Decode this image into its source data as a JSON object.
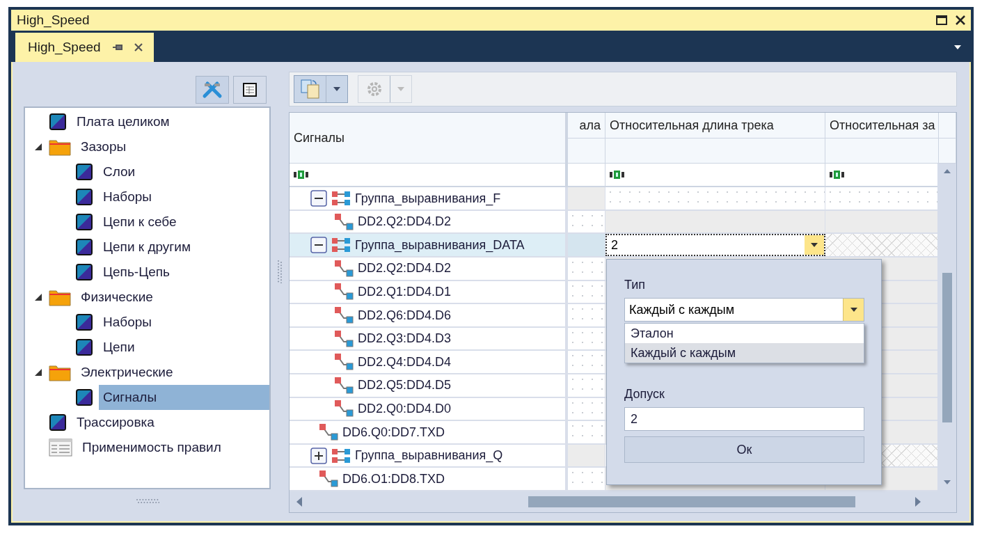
{
  "window": {
    "title": "High_Speed"
  },
  "tabs": [
    {
      "label": "High_Speed",
      "selected": true
    }
  ],
  "rule_tree": [
    {
      "label": "Плата целиком",
      "kind": "rule",
      "selected": false
    },
    {
      "label": "Зазоры",
      "kind": "folder",
      "expanded": true,
      "selected": false,
      "children": [
        {
          "label": "Слои",
          "kind": "rule",
          "selected": false
        },
        {
          "label": "Наборы",
          "kind": "rule",
          "selected": false
        },
        {
          "label": "Цепи к себе",
          "kind": "rule",
          "selected": false
        },
        {
          "label": "Цепи к другим",
          "kind": "rule",
          "selected": false
        },
        {
          "label": "Цепь-Цепь",
          "kind": "rule",
          "selected": false
        }
      ]
    },
    {
      "label": "Физические",
      "kind": "folder",
      "expanded": true,
      "selected": false,
      "children": [
        {
          "label": "Наборы",
          "kind": "rule",
          "selected": false
        },
        {
          "label": "Цепи",
          "kind": "rule",
          "selected": false
        }
      ]
    },
    {
      "label": "Электрические",
      "kind": "folder",
      "expanded": true,
      "selected": false,
      "children": [
        {
          "label": "Сигналы",
          "kind": "rule",
          "selected": true
        }
      ]
    },
    {
      "label": "Трассировка",
      "kind": "rule",
      "selected": false
    },
    {
      "label": "Применимость правил",
      "kind": "table",
      "selected": false
    }
  ],
  "grid": {
    "columns": [
      {
        "label": "Сигналы"
      },
      {
        "label": "ала"
      },
      {
        "label": "Относительная длина трека"
      },
      {
        "label": "Относительная за"
      }
    ],
    "rows": [
      {
        "label": "Группа_выравнивания_F",
        "kind": "group",
        "expanded": true,
        "selected": false,
        "children": [
          {
            "label": "DD2.Q2:DD4.D2",
            "kind": "net",
            "selected": false
          }
        ]
      },
      {
        "label": "Группа_выравнивания_DATA",
        "kind": "group",
        "expanded": true,
        "selected": true,
        "length": "2",
        "children": [
          {
            "label": "DD2.Q2:DD4.D2",
            "kind": "net",
            "selected": false
          },
          {
            "label": "DD2.Q1:DD4.D1",
            "kind": "net",
            "selected": false
          },
          {
            "label": "DD2.Q6:DD4.D6",
            "kind": "net",
            "selected": false
          },
          {
            "label": "DD2.Q3:DD4.D3",
            "kind": "net",
            "selected": false
          },
          {
            "label": "DD2.Q4:DD4.D4",
            "kind": "net",
            "selected": false
          },
          {
            "label": "DD2.Q5:DD4.D5",
            "kind": "net",
            "selected": false
          },
          {
            "label": "DD2.Q0:DD4.D0",
            "kind": "net",
            "selected": false
          }
        ]
      },
      {
        "label": "DD6.Q0:DD7.TXD",
        "kind": "net",
        "selected": false
      },
      {
        "label": "Группа_выравнивания_Q",
        "kind": "group",
        "expanded": false,
        "selected": false
      },
      {
        "label": "DD6.O1:DD8.TXD",
        "kind": "net",
        "selected": false
      }
    ]
  },
  "popup": {
    "type_label": "Тип",
    "type_value": "Каждый с каждым",
    "options": [
      {
        "label": "Эталон",
        "selected": false
      },
      {
        "label": "Каждый с каждым",
        "selected": true
      }
    ],
    "tolerance_label": "Допуск",
    "tolerance_value": "2",
    "ok_button": "Ок"
  }
}
